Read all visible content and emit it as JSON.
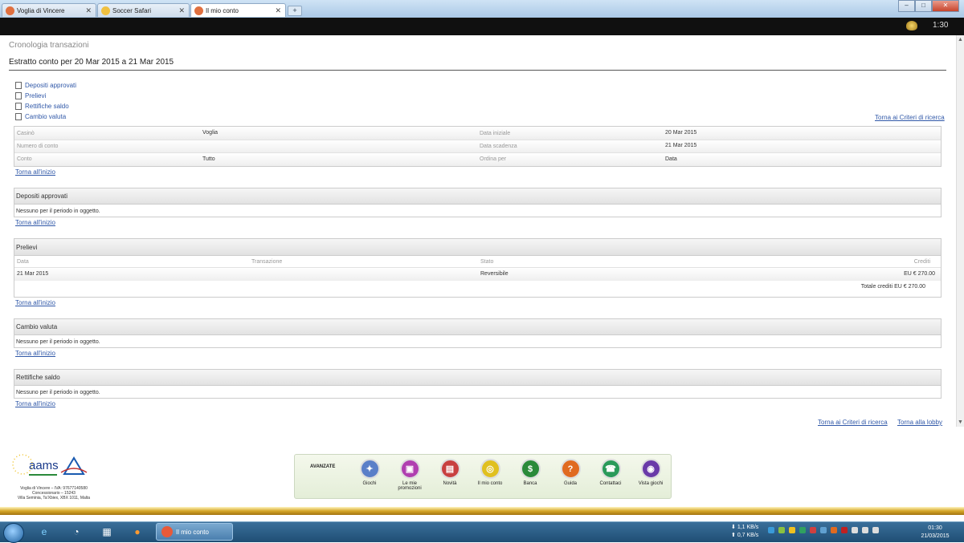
{
  "browser": {
    "tabs": [
      {
        "label": "Voglia di Vincere",
        "icon": "casino-icon",
        "active": false
      },
      {
        "label": "Soccer Safari",
        "icon": "soccer-icon",
        "active": false
      },
      {
        "label": "Il mio conto",
        "icon": "casino-icon",
        "active": true
      }
    ],
    "new_tab_label": "+",
    "window_buttons": {
      "minimize": "–",
      "maximize": "□",
      "close": "✕"
    }
  },
  "appbar": {
    "clock": "1:30",
    "coin_icon": "coins-icon"
  },
  "page": {
    "history_title": "Cronologia transazioni",
    "statement_title": "Estratto conto per 20 Mar 2015 a 21 Mar 2015",
    "quick_links": [
      "Depositi approvati",
      "Prelievi",
      "Rettifiche saldo",
      "Cambio valuta"
    ],
    "back_to_criteria": "Torna ai Criteri di ricerca",
    "back_to_top": "Torna all'inizio",
    "back_to_lobby": "Torna alla lobby",
    "criteria": {
      "casino_label": "Casinò",
      "casino_value": "Voglia",
      "account_number_label": "Numero di conto",
      "account_number_value": "",
      "account_label": "Conto",
      "account_value": "Tutto",
      "start_date_label": "Data iniziale",
      "start_date_value": "20 Mar 2015",
      "end_date_label": "Data scadenza",
      "end_date_value": "21 Mar 2015",
      "order_label": "Ordina per",
      "order_value": "Data"
    },
    "deposits": {
      "title": "Depositi approvati",
      "empty": "Nessuno per il periodo in oggetto."
    },
    "withdrawals": {
      "title": "Prelievi",
      "columns": [
        "Data",
        "Transazione",
        "Stato",
        "Crediti"
      ],
      "rows": [
        {
          "date": "21 Mar 2015",
          "transaction": "",
          "status": "Reversibile",
          "credits": "EU € 270.00"
        }
      ],
      "total_label": "Totale crediti",
      "total_value": "EU € 270.00"
    },
    "currency": {
      "title": "Cambio valuta",
      "empty": "Nessuno per il periodo in oggetto."
    },
    "adjustments": {
      "title": "Rettifiche saldo",
      "empty": "Nessuno per il periodo in oggetto."
    }
  },
  "footer": {
    "aams_logo_text": "aams",
    "company_lines": [
      "Voglia di Vincere – IVA: 97677140580",
      "Concessionario – 15243",
      "Villa Seminia, Ta'Xbiex, XBX 1011, Malta"
    ],
    "panel_label": "AVANZATE",
    "games": [
      {
        "label": "Giochi",
        "color": "#5a7fc8"
      },
      {
        "label": "Le mie promozioni",
        "color": "#b03fb0"
      },
      {
        "label": "Novità",
        "color": "#c84040"
      },
      {
        "label": "Il mio conto",
        "color": "#e0c020"
      },
      {
        "label": "Banca",
        "color": "#2a8a3a"
      },
      {
        "label": "Guida",
        "color": "#e06a20"
      },
      {
        "label": "Contattaci",
        "color": "#2a9a5a"
      },
      {
        "label": "Vista giochi",
        "color": "#6a3aa8"
      }
    ]
  },
  "taskbar": {
    "task_label": "Il mio conto",
    "net_down": "1,1 KB/s",
    "net_up": "0,7 KB/s",
    "time": "01:30",
    "date": "21/03/2015"
  }
}
